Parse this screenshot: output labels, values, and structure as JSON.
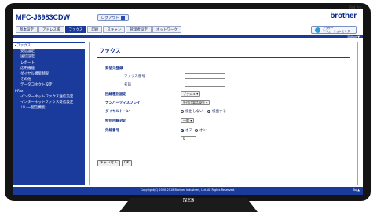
{
  "device": {
    "camera_label": "iPad Pro",
    "stand_brand": "NES"
  },
  "header": {
    "model": "MFC-J6983CDW",
    "logout_label": "ログアウト",
    "brand": "brother",
    "tabs": [
      {
        "label": "基本設定",
        "active": false
      },
      {
        "label": "アドレス帳",
        "active": false
      },
      {
        "label": "ファクス",
        "active": true
      },
      {
        "label": "印刷",
        "active": false
      },
      {
        "label": "スキャン",
        "active": false
      },
      {
        "label": "管理者設定",
        "active": false
      },
      {
        "label": "ネットワーク",
        "active": false
      }
    ],
    "solutions_line1": "ブラザー",
    "solutions_line2": "ソリューションセンター",
    "bottom_link": "Bottom▼"
  },
  "sidebar": {
    "items": [
      {
        "label": "▸ファクス",
        "level": "top",
        "active": true
      },
      {
        "label": "受信設定",
        "level": "sub",
        "active": false
      },
      {
        "label": "送信設定",
        "level": "sub",
        "active": false
      },
      {
        "label": "レポート",
        "level": "sub",
        "active": false
      },
      {
        "label": "応用機能",
        "level": "sub",
        "active": false
      },
      {
        "label": "ダイヤル機能制限",
        "level": "sub",
        "active": false
      },
      {
        "label": "その他",
        "level": "sub",
        "active": false
      },
      {
        "label": "データコネクト設定",
        "level": "sub",
        "active": false
      },
      {
        "label": "I-Fax",
        "level": "top",
        "active": false
      },
      {
        "label": "インターネットファクス送信設定",
        "level": "sub",
        "active": false
      },
      {
        "label": "インターネットファクス受信設定",
        "level": "sub",
        "active": false
      },
      {
        "label": "リレー配信機能",
        "level": "sub",
        "active": false
      }
    ]
  },
  "main": {
    "title": "ファクス",
    "section_header": "発信元登録",
    "fax_number_label": "ファクス番号",
    "fax_number_value": "",
    "name_label": "名前",
    "name_value": "",
    "line_type_label": "回線種別設定",
    "line_type_value": "プッシュ",
    "number_display_label": "ナンバーディスプレイ",
    "number_display_value": "外付け電話優先",
    "dial_tone_label": "ダイヤルトーン",
    "dial_tone_options": [
      "検出しない",
      "検出する"
    ],
    "dial_tone_selected": "検出する",
    "special_line_label": "特別回線対応",
    "special_line_value": "一般",
    "outside_line_label": "外線番号",
    "outside_line_options": [
      "オフ",
      "オン"
    ],
    "outside_line_selected": "オフ",
    "outside_line_number": "0",
    "cancel_label": "キャンセル",
    "ok_label": "OK"
  },
  "footer": {
    "copyright": "Copyright(C) 2000-2018 Brother Industries, Ltd. All Rights Reserved.",
    "top_link": "Top▲"
  },
  "colors": {
    "brand_blue": "#1a3a9c",
    "title_blue": "#0a2a8c"
  }
}
